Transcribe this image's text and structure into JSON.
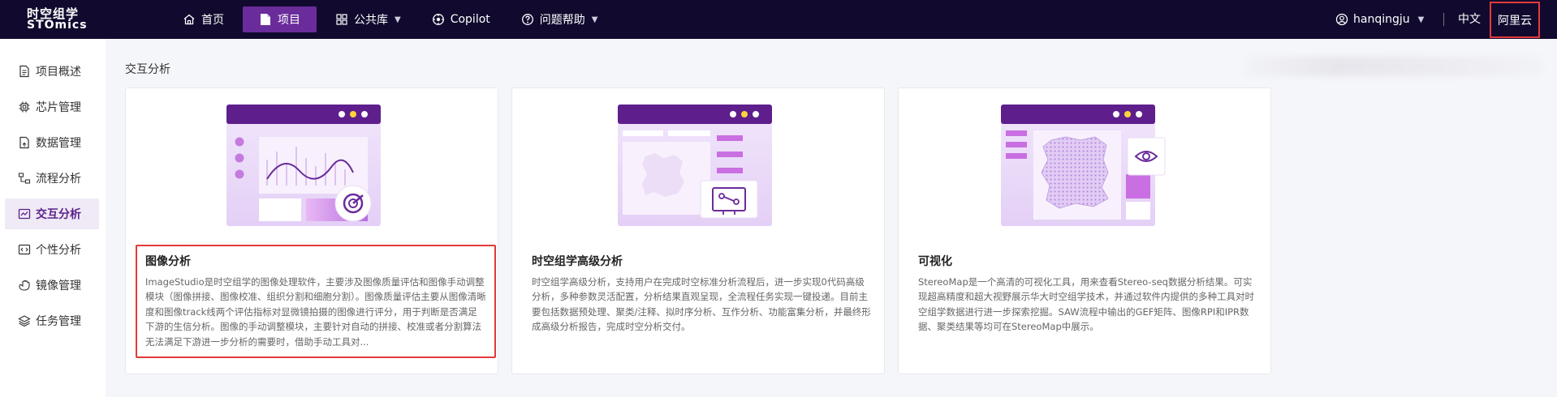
{
  "brand": {
    "line1": "时空组学",
    "line2": "STOmics"
  },
  "nav": {
    "items": [
      {
        "label": "首页",
        "icon": "home-icon"
      },
      {
        "label": "项目",
        "icon": "file-icon",
        "active": true
      },
      {
        "label": "公共库",
        "icon": "grid-icon",
        "dropdown": true
      },
      {
        "label": "Copilot",
        "icon": "copilot-icon"
      },
      {
        "label": "问题帮助",
        "icon": "help-icon",
        "dropdown": true
      }
    ]
  },
  "user": {
    "name": "hanqingju"
  },
  "lang": "中文",
  "cloud": "阿里云",
  "sidebar": {
    "items": [
      {
        "label": "项目概述",
        "icon": "doc-icon"
      },
      {
        "label": "芯片管理",
        "icon": "chip-icon"
      },
      {
        "label": "数据管理",
        "icon": "data-file-icon"
      },
      {
        "label": "流程分析",
        "icon": "flow-icon"
      },
      {
        "label": "交互分析",
        "icon": "chart-window-icon",
        "active": true
      },
      {
        "label": "个性分析",
        "icon": "code-icon"
      },
      {
        "label": "镜像管理",
        "icon": "hand-icon"
      },
      {
        "label": "任务管理",
        "icon": "layers-icon"
      }
    ]
  },
  "main": {
    "section_title": "交互分析",
    "cards": [
      {
        "title": "图像分析",
        "desc": "ImageStudio是时空组学的图像处理软件，主要涉及图像质量评估和图像手动调整模块（图像拼接、图像校准、组织分割和细胞分割）。图像质量评估主要从图像清晰度和图像track线两个评估指标对显微镜拍摄的图像进行评分，用于判断是否满足下游的生信分析。图像的手动调整模块，主要针对自动的拼接、校准或者分割算法无法满足下游进一步分析的需要时，借助手动工具对..."
      },
      {
        "title": "时空组学高级分析",
        "desc": "时空组学高级分析，支持用户在完成时空标准分析流程后，进一步实现0代码高级分析，多种参数灵活配置，分析结果直观呈现，全流程任务实现一键投递。目前主要包括数据预处理、聚类/注释、拟时序分析、互作分析、功能富集分析，并最终形成高级分析报告，完成时空分析交付。"
      },
      {
        "title": "可视化",
        "desc": "StereoMap是一个高清的可视化工具，用来查看Stereo-seq数据分析结果。可实现超高精度和超大视野展示华大时空组学技术，并通过软件内提供的多种工具对时空组学数据进行进一步探索挖掘。SAW流程中输出的GEF矩阵、图像RPI和IPR数据、聚类结果等均可在StereoMap中展示。"
      }
    ]
  },
  "colors": {
    "topbar": "#110a2e",
    "accent": "#6a2c9a",
    "highlight": "#e23a3a"
  }
}
